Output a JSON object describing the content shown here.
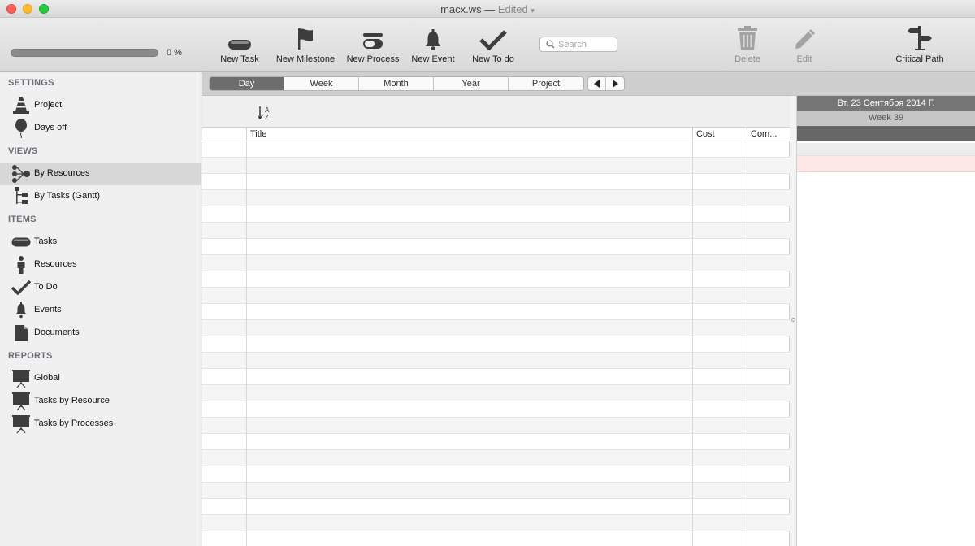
{
  "window": {
    "title": "macx.ws",
    "dash": "—",
    "status": "Edited"
  },
  "progress": {
    "value": 0,
    "label": "0 %"
  },
  "toolbar": {
    "new_task": "New Task",
    "new_milestone": "New Milestone",
    "new_process": "New Process",
    "new_event": "New Event",
    "new_todo": "New To do",
    "search_placeholder": "Search",
    "delete": "Delete",
    "edit": "Edit",
    "critical_path": "Critical Path"
  },
  "sidebar": {
    "settings": {
      "header": "SETTINGS",
      "items": [
        {
          "label": "Project",
          "icon": "traffic-cone-icon"
        },
        {
          "label": "Days off",
          "icon": "balloon-icon"
        }
      ]
    },
    "views": {
      "header": "VIEWS",
      "items": [
        {
          "label": "By Resources",
          "icon": "resource-tree-icon",
          "selected": true
        },
        {
          "label": "By Tasks (Gantt)",
          "icon": "gantt-tree-icon"
        }
      ]
    },
    "items": {
      "header": "ITEMS",
      "items": [
        {
          "label": "Tasks",
          "icon": "task-pill-icon"
        },
        {
          "label": "Resources",
          "icon": "person-icon"
        },
        {
          "label": "To Do",
          "icon": "checkmark-icon"
        },
        {
          "label": "Events",
          "icon": "bell-icon"
        },
        {
          "label": "Documents",
          "icon": "document-icon"
        }
      ]
    },
    "reports": {
      "header": "REPORTS",
      "items": [
        {
          "label": "Global",
          "icon": "presentation-board-icon"
        },
        {
          "label": "Tasks by Resource",
          "icon": "presentation-board-icon"
        },
        {
          "label": "Tasks by Processes",
          "icon": "presentation-board-icon"
        }
      ]
    }
  },
  "scale": {
    "segments": [
      "Day",
      "Week",
      "Month",
      "Year",
      "Project"
    ],
    "active": "Day"
  },
  "table": {
    "columns": [
      "",
      "Title",
      "Cost",
      "Com..."
    ],
    "row_count": 25
  },
  "gantt": {
    "date": "Вт, 23 Сентября 2014 Г.",
    "week": "Week 39"
  },
  "colors": {
    "accent_selected_segment": "#6d6d6d",
    "selection": "#d7d7d7",
    "highlight_row": "#fde7e7"
  }
}
